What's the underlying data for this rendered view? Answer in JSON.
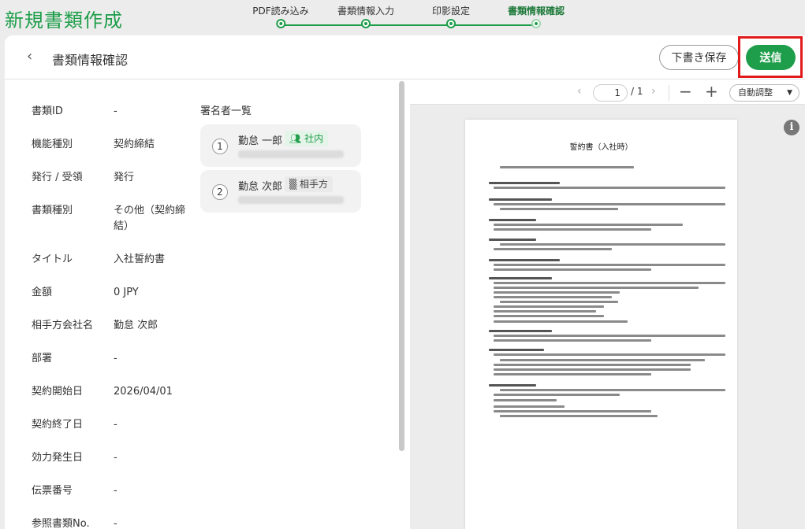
{
  "app": {
    "title": "新規書類作成"
  },
  "stepper": {
    "steps": [
      {
        "label": "PDF読み込み"
      },
      {
        "label": "書類情報入力"
      },
      {
        "label": "印影設定"
      },
      {
        "label": "書類情報確認"
      }
    ]
  },
  "header": {
    "title": "書類情報確認",
    "draft_label": "下書き保存",
    "send_label": "送信"
  },
  "info": [
    {
      "key": "書類ID",
      "value": "-"
    },
    {
      "key": "機能種別",
      "value": "契約締結"
    },
    {
      "key": "発行 / 受領",
      "value": "発行"
    },
    {
      "key": "書類種別",
      "value": "その他（契約締結）"
    },
    {
      "key": "タイトル",
      "value": "入社誓約書"
    },
    {
      "key": "金額",
      "value": "0 JPY"
    },
    {
      "key": "相手方会社名",
      "value": "勤怠 次郎"
    },
    {
      "key": "部署",
      "value": "-"
    },
    {
      "key": "契約開始日",
      "value": "2026/04/01"
    },
    {
      "key": "契約終了日",
      "value": "-"
    },
    {
      "key": "効力発生日",
      "value": "-"
    },
    {
      "key": "伝票番号",
      "value": "-"
    },
    {
      "key": "参照書類No.",
      "value": "-"
    }
  ],
  "signers": {
    "title": "署名者一覧",
    "items": [
      {
        "num": "1",
        "name": "勤怠 一郎",
        "tag": "社内"
      },
      {
        "num": "2",
        "name": "勤怠 次郎",
        "tag": "相手方"
      }
    ]
  },
  "viewer": {
    "page": "1",
    "total": "/ 1",
    "zoom_label": "自動調整",
    "info_icon_text": "i",
    "doc_title": "誓約書（入社時）"
  }
}
